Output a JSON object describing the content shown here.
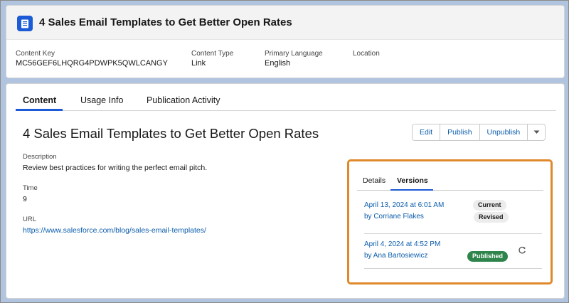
{
  "header": {
    "title": "4 Sales Email Templates to Get Better Open Rates",
    "icon": "document-icon",
    "fields": [
      {
        "label": "Content Key",
        "value": "MC56GEF6LHQRG4PDWPK5QWLCANGY"
      },
      {
        "label": "Content Type",
        "value": "Link"
      },
      {
        "label": "Primary Language",
        "value": "English"
      },
      {
        "label": "Location",
        "value": ""
      }
    ]
  },
  "tabs": [
    {
      "label": "Content",
      "active": true
    },
    {
      "label": "Usage Info",
      "active": false
    },
    {
      "label": "Publication Activity",
      "active": false
    }
  ],
  "content": {
    "title": "4 Sales Email Templates to Get Better Open Rates",
    "actions": {
      "edit": "Edit",
      "publish": "Publish",
      "unpublish": "Unpublish",
      "more_icon": "chevron-down-icon"
    },
    "description_label": "Description",
    "description_value": "Review best practices for writing the perfect email pitch.",
    "time_label": "Time",
    "time_value": "9",
    "url_label": "URL",
    "url_value": "https://www.salesforce.com/blog/sales-email-templates/"
  },
  "versions_panel": {
    "tabs": [
      {
        "label": "Details",
        "active": false
      },
      {
        "label": "Versions",
        "active": true
      }
    ],
    "versions": [
      {
        "date": "April 13, 2024 at 6:01 AM",
        "author": "by Corriane Flakes",
        "badges": [
          "Current",
          "Revised"
        ]
      },
      {
        "date": "April 4, 2024 at 4:52 PM",
        "author": "by Ana Bartosiewicz",
        "badges": [
          "Published"
        ],
        "action_icon": "refresh-icon"
      }
    ]
  },
  "colors": {
    "accent": "#1b5bd6",
    "link": "#0b5cab",
    "highlight_border": "#e0892a",
    "published_badge": "#2e844a",
    "background": "#b0c4df"
  }
}
